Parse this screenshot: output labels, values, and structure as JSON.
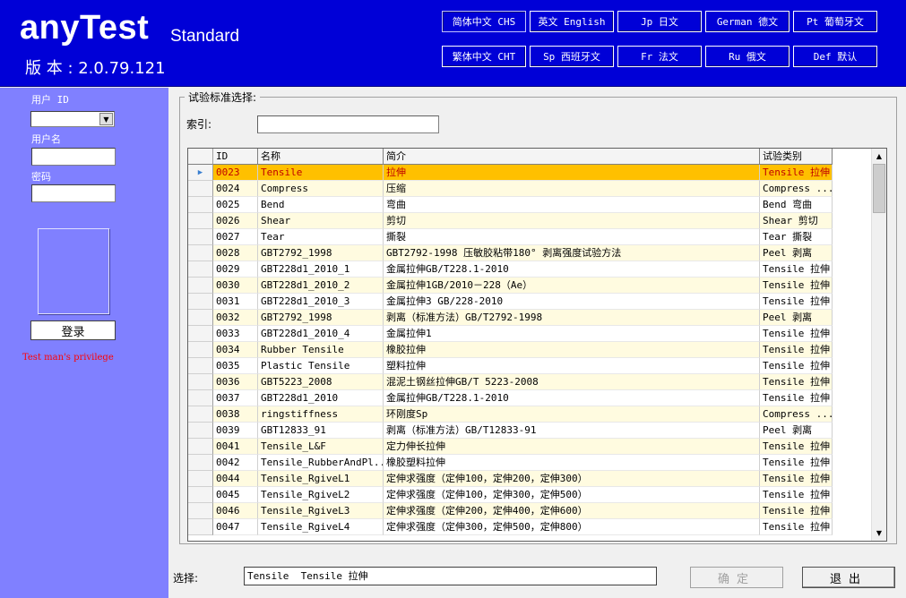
{
  "header": {
    "logo": "anyTest",
    "edition": "Standard",
    "version": "版 本 : 2.0.79.121",
    "languages": [
      "简体中文 CHS",
      "英文 English",
      "Jp 日文",
      "German 德文",
      "Pt 葡萄牙文",
      "繁体中文 CHT",
      "Sp 西班牙文",
      "Fr 法文",
      "Ru 俄文",
      "Def 默认"
    ]
  },
  "login": {
    "user_id_label": "用户 ID",
    "username_label": "用户名",
    "password_label": "密码",
    "login_button": "登录",
    "privilege_text": "Test man's privilege"
  },
  "main": {
    "group_title": "试验标准选择:",
    "index_label": "索引:",
    "grid": {
      "columns": [
        "ID",
        "名称",
        "简介",
        "试验类别"
      ],
      "rows": [
        [
          "0023",
          "Tensile",
          "拉伸",
          "Tensile 拉伸"
        ],
        [
          "0024",
          "Compress",
          "压缩",
          "Compress ..."
        ],
        [
          "0025",
          "Bend",
          "弯曲",
          "Bend 弯曲"
        ],
        [
          "0026",
          "Shear",
          "剪切",
          "Shear 剪切"
        ],
        [
          "0027",
          "Tear",
          "撕裂",
          "Tear 撕裂"
        ],
        [
          "0028",
          "GBT2792_1998",
          "GBT2792-1998 压敏胶粘带180° 剥离强度试验方法",
          "Peel 剥离"
        ],
        [
          "0029",
          "GBT228d1_2010_1",
          "金属拉伸GB/T228.1-2010",
          "Tensile 拉伸"
        ],
        [
          "0030",
          "GBT228d1_2010_2",
          "金属拉伸1GB/2010－228（Ae）",
          "Tensile 拉伸"
        ],
        [
          "0031",
          "GBT228d1_2010_3",
          "金属拉伸3 GB/228-2010",
          "Tensile 拉伸"
        ],
        [
          "0032",
          "GBT2792_1998",
          "剥离（标准方法）GB/T2792-1998",
          "Peel 剥离"
        ],
        [
          "0033",
          "GBT228d1_2010_4",
          "金属拉伸1",
          "Tensile 拉伸"
        ],
        [
          "0034",
          "Rubber Tensile",
          "橡胶拉伸",
          "Tensile 拉伸"
        ],
        [
          "0035",
          "Plastic Tensile",
          "塑料拉伸",
          "Tensile 拉伸"
        ],
        [
          "0036",
          "GBT5223_2008",
          "混泥土钢丝拉伸GB/T 5223-2008",
          "Tensile 拉伸"
        ],
        [
          "0037",
          "GBT228d1_2010",
          "金属拉伸GB/T228.1-2010",
          "Tensile 拉伸"
        ],
        [
          "0038",
          "ringstiffness",
          "环刚度Sp",
          "Compress ..."
        ],
        [
          "0039",
          "GBT12833_91",
          "剥离（标准方法）GB/T12833-91",
          "Peel 剥离"
        ],
        [
          "0041",
          "Tensile_L&F",
          "定力伸长拉伸",
          "Tensile 拉伸"
        ],
        [
          "0042",
          "Tensile_RubberAndPl...",
          "橡胶塑料拉伸",
          "Tensile 拉伸"
        ],
        [
          "0044",
          "Tensile_RgiveL1",
          "定伸求强度（定伸100，定伸200，定伸300）",
          "Tensile 拉伸"
        ],
        [
          "0045",
          "Tensile_RgiveL2",
          "定伸求强度（定伸100，定伸300，定伸500）",
          "Tensile 拉伸"
        ],
        [
          "0046",
          "Tensile_RgiveL3",
          "定伸求强度（定伸200，定伸400，定伸600）",
          "Tensile 拉伸"
        ],
        [
          "0047",
          "Tensile_RgiveL4",
          "定伸求强度（定伸300，定伸500，定伸800）",
          "Tensile 拉伸"
        ]
      ],
      "selected_index": 0
    }
  },
  "footer": {
    "select_label": "选择:",
    "select_value": "Tensile  Tensile 拉伸",
    "ok_button": "确定",
    "exit_button": "退出"
  },
  "colors": {
    "header_bg": "#0000d7",
    "sidebar_bg": "#8080ff",
    "selected_row_bg": "#ffc000",
    "selected_row_text": "#c00000",
    "alt_row_bg": "#fffbe0",
    "privilege_text": "#ff0000"
  }
}
